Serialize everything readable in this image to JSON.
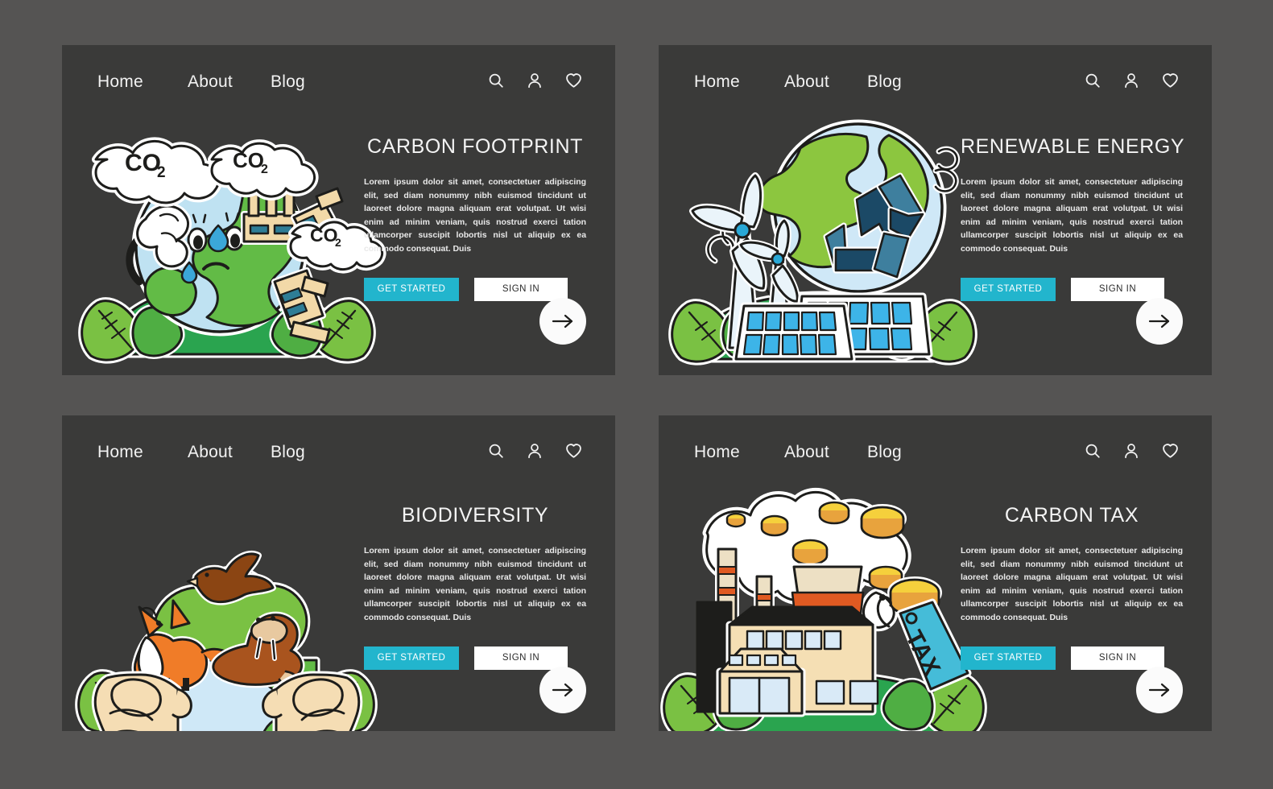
{
  "theme": {
    "page_bg": "#555453",
    "panel_bg": "#3a3a39",
    "accent": "#22b5cd",
    "text_light": "#f2f2f2",
    "button_secondary_bg": "#ffffff"
  },
  "nav": {
    "links": [
      {
        "label": "Home"
      },
      {
        "label": "About"
      },
      {
        "label": "Blog"
      }
    ],
    "icons": [
      {
        "name": "search-icon"
      },
      {
        "name": "user-icon"
      },
      {
        "name": "heart-icon"
      }
    ]
  },
  "common": {
    "body_copy": "Lorem ipsum dolor sit amet, consectetuer adipiscing elit, sed diam nonummy nibh euismod tincidunt ut laoreet dolore magna aliquam erat volutpat. Ut wisi enim ad minim veniam, quis nostrud exerci tation ullamcorper suscipit lobortis nisl ut aliquip ex ea commodo consequat. Duis",
    "primary_button": "GET STARTED",
    "secondary_button": "SIGN IN",
    "next_arrow": "→"
  },
  "panels": [
    {
      "id": "carbon-footprint",
      "heading": "CARBON FOOTPRINT",
      "illustration": {
        "name": "crying-earth-with-factories",
        "labels": [
          "CO",
          "CO",
          "CO"
        ],
        "subscript": "2"
      }
    },
    {
      "id": "renewable-energy",
      "heading": "RENEWABLE ENERGY",
      "illustration": {
        "name": "wind-turbines-solar-panels-earth-recycle"
      }
    },
    {
      "id": "biodiversity",
      "heading": "BIODIVERSITY",
      "illustration": {
        "name": "hands-holding-earth-with-animals"
      }
    },
    {
      "id": "carbon-tax",
      "heading": "CARBON TAX",
      "illustration": {
        "name": "factory-with-coins-and-tax-tag",
        "tag_label": "TAX"
      }
    }
  ]
}
